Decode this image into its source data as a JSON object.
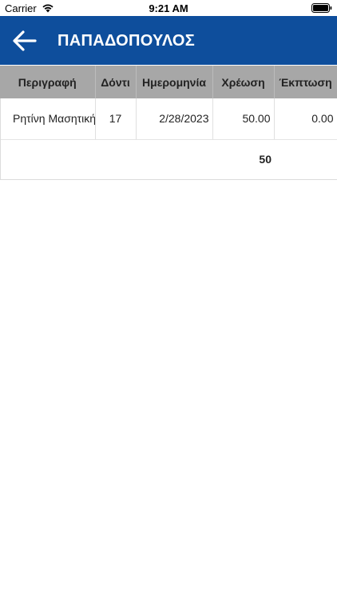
{
  "status_bar": {
    "carrier": "Carrier",
    "time": "9:21 AM"
  },
  "header": {
    "title": "ΠΑΠΑΔΟΠΟΥΛΟΣ",
    "background": "#0e4e9c"
  },
  "table": {
    "columns": [
      "Περιγραφή",
      "Δόντι",
      "Ημερομηνία",
      "Χρέωση",
      "Έκπτωση"
    ],
    "rows": [
      {
        "description": "Ρητίνη Μασητική",
        "tooth": "17",
        "date": "2/28/2023",
        "charge": "50.00",
        "discount": "0.00"
      }
    ],
    "total": "50"
  },
  "icons": {
    "back": "arrow-left-icon",
    "wifi": "wifi-icon",
    "battery": "battery-icon"
  }
}
